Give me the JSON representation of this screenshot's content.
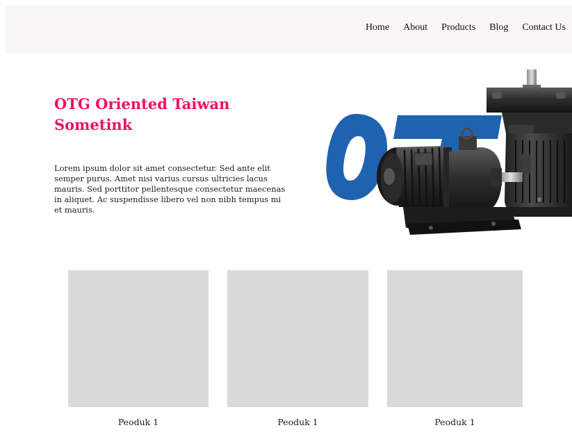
{
  "nav": {
    "items": [
      {
        "label": "Home"
      },
      {
        "label": "About"
      },
      {
        "label": "Products"
      },
      {
        "label": "Blog"
      },
      {
        "label": "Contact Us"
      }
    ]
  },
  "hero": {
    "title": "OTG Oriented Taiwan Sometink",
    "description": "Lorem ipsum dolor sit amet consectetur. Sed ante elit semper purus. Amet nisi varius cursus ultricies lacus mauris. Sed porttitor pellentesque consectetur maecenas in aliquet. Ac suspendisse libero vel non nibh tempus mi et mauris.",
    "image_logo_text": "OTG",
    "logo_color": "#1f63b0"
  },
  "products": [
    {
      "name": "Peoduk 1"
    },
    {
      "name": "Peoduk 1"
    },
    {
      "name": "Peoduk 1"
    }
  ],
  "colors": {
    "accent": "#ee1161",
    "nav_background": "#f9f6f6",
    "placeholder": "#d9d9d9"
  }
}
